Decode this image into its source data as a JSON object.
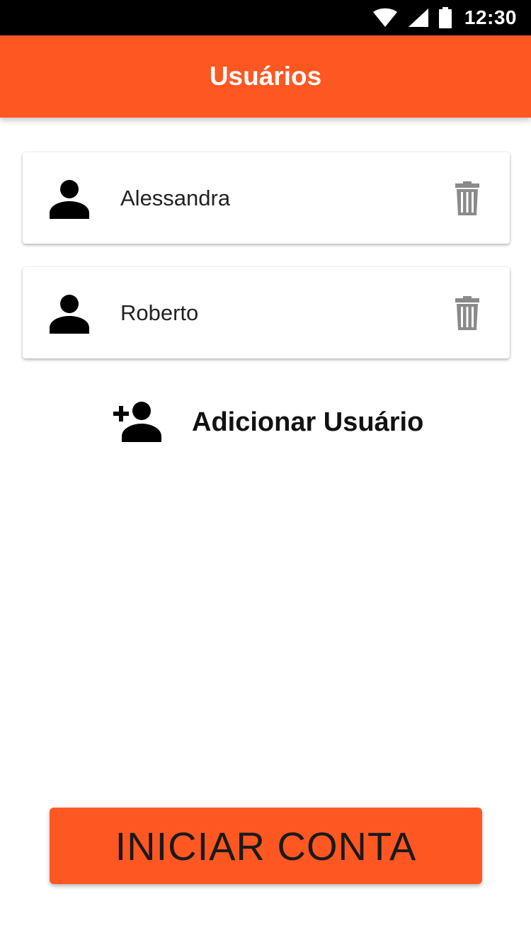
{
  "status_bar": {
    "time": "12:30",
    "icons": [
      "wifi-icon",
      "signal-icon",
      "battery-icon"
    ]
  },
  "app_bar": {
    "title": "Usuários",
    "color": "#ff5722"
  },
  "users": [
    {
      "name": "Alessandra",
      "icon": "person-icon",
      "action_icon": "trash-icon"
    },
    {
      "name": "Roberto",
      "icon": "person-icon",
      "action_icon": "trash-icon"
    }
  ],
  "add_user": {
    "label": "Adicionar Usuário",
    "icon": "person-add-icon"
  },
  "start_button": {
    "label": "INICIAR CONTA",
    "color": "#ff5722"
  },
  "colors": {
    "accent": "#ff5722",
    "icon_gray": "#8a8a8a",
    "text": "#222222"
  }
}
